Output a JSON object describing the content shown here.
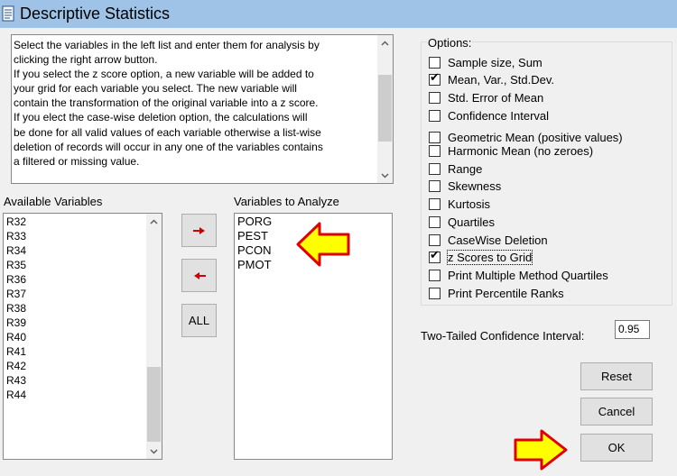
{
  "window": {
    "title": "Descriptive Statistics",
    "icon": "app-document-icon"
  },
  "description": {
    "lines": [
      "Select the variables in the left list and enter them for analysis by",
      "clicking the right arrow button.",
      "If you select the z score option, a new variable will be added to",
      "your grid for each variable you select.  The new variable will",
      "contain the transformation of the original variable into a z score.",
      "If you elect the case-wise deletion option, the calculations will",
      "be done for all valid values of each variable otherwise a list-wise",
      "deletion of records will occur in any one of the variables contains",
      "a filtered or missing value."
    ]
  },
  "available": {
    "label": "Available Variables",
    "items": [
      "R32",
      "R33",
      "R34",
      "R35",
      "R36",
      "R37",
      "R38",
      "R39",
      "R40",
      "R41",
      "R42",
      "R43",
      "R44"
    ]
  },
  "analyze": {
    "label": "Variables to Analyze",
    "items": [
      "PORG",
      "PEST",
      "PCON",
      "PMOT"
    ]
  },
  "transfer": {
    "right_icon": "right-arrow-icon",
    "left_icon": "left-arrow-icon",
    "all_label": "ALL",
    "arrow_color": "#cc0000"
  },
  "options": {
    "label": "Options:",
    "items": [
      {
        "label": "Sample size, Sum",
        "checked": false
      },
      {
        "label": "Mean, Var., Std.Dev.",
        "checked": true
      },
      {
        "label": "Std. Error of Mean",
        "checked": false
      },
      {
        "label": "Confidence Interval",
        "checked": false
      },
      {
        "label": "Geometric Mean (positive values)",
        "checked": false
      },
      {
        "label": "Harmonic Mean (no zeroes)",
        "checked": false
      },
      {
        "label": "Range",
        "checked": false
      },
      {
        "label": "Skewness",
        "checked": false
      },
      {
        "label": "Kurtosis",
        "checked": false
      },
      {
        "label": "Quartiles",
        "checked": false
      },
      {
        "label": "CaseWise Deletion",
        "checked": false
      },
      {
        "label": "z Scores to Grid",
        "checked": true
      },
      {
        "label": "Print Multiple Method Quartiles",
        "checked": false
      },
      {
        "label": "Print Percentile Ranks",
        "checked": false
      }
    ]
  },
  "confidence": {
    "label": "Two-Tailed Confidence Interval:",
    "value": "0.95"
  },
  "buttons": {
    "reset": "Reset",
    "cancel": "Cancel",
    "ok": "OK"
  },
  "annotations": {
    "arrow_fill": "#ffff00",
    "arrow_stroke": "#e00000"
  }
}
